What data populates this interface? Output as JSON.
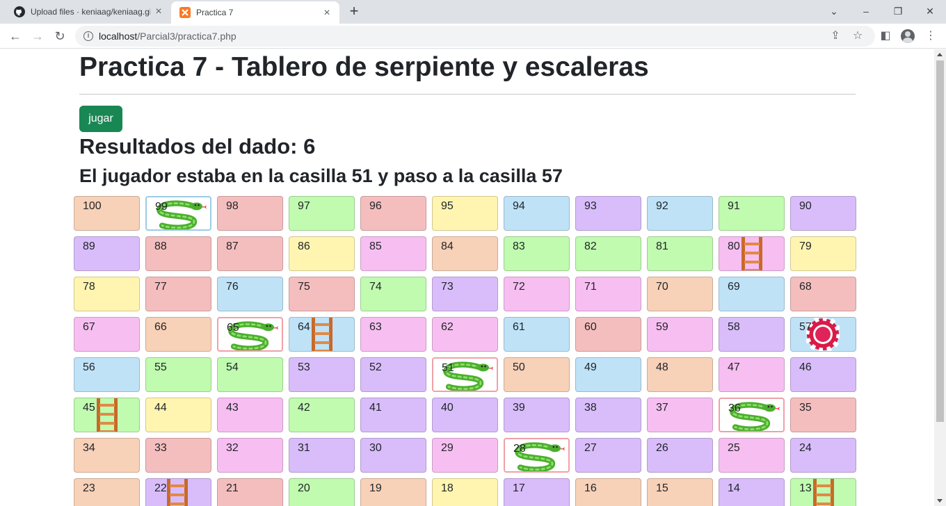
{
  "browser": {
    "tabs": [
      {
        "title": "Upload files · keniaag/keniaag.gi",
        "icon": "github-icon"
      },
      {
        "title": "Practica 7",
        "icon": "xampp-icon"
      }
    ],
    "address": {
      "host": "localhost",
      "path": "/Parcial3/practica7.php"
    }
  },
  "page": {
    "title": "Practica 7 - Tablero de serpiente y escaleras",
    "button_label": "jugar",
    "dice_result": "Resultados del dado: 6",
    "move_text": "El jugador estaba en la casilla 51 y paso a la casilla 57"
  },
  "palette": {
    "peach": "#f7d1b8",
    "red": "#f5bebe",
    "green": "#c0fbb0",
    "yellow": "#fff5b0",
    "blue": "#bfe2f7",
    "purple": "#d9bdfa",
    "pink": "#f7bff1",
    "white": "#ffffff"
  },
  "board": {
    "rows": [
      [
        {
          "n": "100",
          "c": "peach"
        },
        {
          "n": "99",
          "c": "white",
          "i": "snake"
        },
        {
          "n": "98",
          "c": "red"
        },
        {
          "n": "97",
          "c": "green"
        },
        {
          "n": "96",
          "c": "red"
        },
        {
          "n": "95",
          "c": "yellow"
        },
        {
          "n": "94",
          "c": "blue"
        },
        {
          "n": "93",
          "c": "purple"
        },
        {
          "n": "92",
          "c": "blue"
        },
        {
          "n": "91",
          "c": "green"
        },
        {
          "n": "90",
          "c": "purple"
        }
      ],
      [
        {
          "n": "89",
          "c": "purple"
        },
        {
          "n": "88",
          "c": "red"
        },
        {
          "n": "87",
          "c": "red"
        },
        {
          "n": "86",
          "c": "yellow"
        },
        {
          "n": "85",
          "c": "pink"
        },
        {
          "n": "84",
          "c": "peach"
        },
        {
          "n": "83",
          "c": "green"
        },
        {
          "n": "82",
          "c": "green"
        },
        {
          "n": "81",
          "c": "green"
        },
        {
          "n": "80",
          "c": "pink",
          "i": "ladder"
        },
        {
          "n": "79",
          "c": "yellow"
        }
      ],
      [
        {
          "n": "78",
          "c": "yellow"
        },
        {
          "n": "77",
          "c": "red"
        },
        {
          "n": "76",
          "c": "blue"
        },
        {
          "n": "75",
          "c": "red"
        },
        {
          "n": "74",
          "c": "green"
        },
        {
          "n": "73",
          "c": "purple"
        },
        {
          "n": "72",
          "c": "pink"
        },
        {
          "n": "71",
          "c": "pink"
        },
        {
          "n": "70",
          "c": "peach"
        },
        {
          "n": "69",
          "c": "blue"
        },
        {
          "n": "68",
          "c": "red"
        }
      ],
      [
        {
          "n": "67",
          "c": "pink"
        },
        {
          "n": "66",
          "c": "peach"
        },
        {
          "n": "65",
          "c": "white",
          "i": "snake"
        },
        {
          "n": "64",
          "c": "blue",
          "i": "ladder"
        },
        {
          "n": "63",
          "c": "pink"
        },
        {
          "n": "62",
          "c": "pink"
        },
        {
          "n": "61",
          "c": "blue"
        },
        {
          "n": "60",
          "c": "red"
        },
        {
          "n": "59",
          "c": "pink"
        },
        {
          "n": "58",
          "c": "purple"
        },
        {
          "n": "57",
          "c": "blue",
          "i": "chip"
        }
      ],
      [
        {
          "n": "56",
          "c": "blue"
        },
        {
          "n": "55",
          "c": "green"
        },
        {
          "n": "54",
          "c": "green"
        },
        {
          "n": "53",
          "c": "purple"
        },
        {
          "n": "52",
          "c": "purple"
        },
        {
          "n": "51",
          "c": "white",
          "i": "snake"
        },
        {
          "n": "50",
          "c": "peach"
        },
        {
          "n": "49",
          "c": "blue"
        },
        {
          "n": "48",
          "c": "peach"
        },
        {
          "n": "47",
          "c": "pink"
        },
        {
          "n": "46",
          "c": "purple"
        }
      ],
      [
        {
          "n": "45",
          "c": "green",
          "i": "ladder"
        },
        {
          "n": "44",
          "c": "yellow"
        },
        {
          "n": "43",
          "c": "pink"
        },
        {
          "n": "42",
          "c": "green"
        },
        {
          "n": "41",
          "c": "purple"
        },
        {
          "n": "40",
          "c": "purple"
        },
        {
          "n": "39",
          "c": "purple"
        },
        {
          "n": "38",
          "c": "purple"
        },
        {
          "n": "37",
          "c": "pink"
        },
        {
          "n": "36",
          "c": "white",
          "i": "snake"
        },
        {
          "n": "35",
          "c": "red"
        }
      ],
      [
        {
          "n": "34",
          "c": "peach"
        },
        {
          "n": "33",
          "c": "red"
        },
        {
          "n": "32",
          "c": "pink"
        },
        {
          "n": "31",
          "c": "purple"
        },
        {
          "n": "30",
          "c": "purple"
        },
        {
          "n": "29",
          "c": "pink"
        },
        {
          "n": "28",
          "c": "white",
          "i": "snake"
        },
        {
          "n": "27",
          "c": "purple"
        },
        {
          "n": "26",
          "c": "purple"
        },
        {
          "n": "25",
          "c": "pink"
        },
        {
          "n": "24",
          "c": "purple"
        }
      ],
      [
        {
          "n": "23",
          "c": "peach"
        },
        {
          "n": "22",
          "c": "purple",
          "i": "ladder"
        },
        {
          "n": "21",
          "c": "red"
        },
        {
          "n": "20",
          "c": "green"
        },
        {
          "n": "19",
          "c": "peach"
        },
        {
          "n": "18",
          "c": "yellow"
        },
        {
          "n": "17",
          "c": "purple"
        },
        {
          "n": "16",
          "c": "peach"
        },
        {
          "n": "15",
          "c": "peach"
        },
        {
          "n": "14",
          "c": "purple"
        },
        {
          "n": "13",
          "c": "green",
          "i": "ladder"
        }
      ]
    ]
  }
}
